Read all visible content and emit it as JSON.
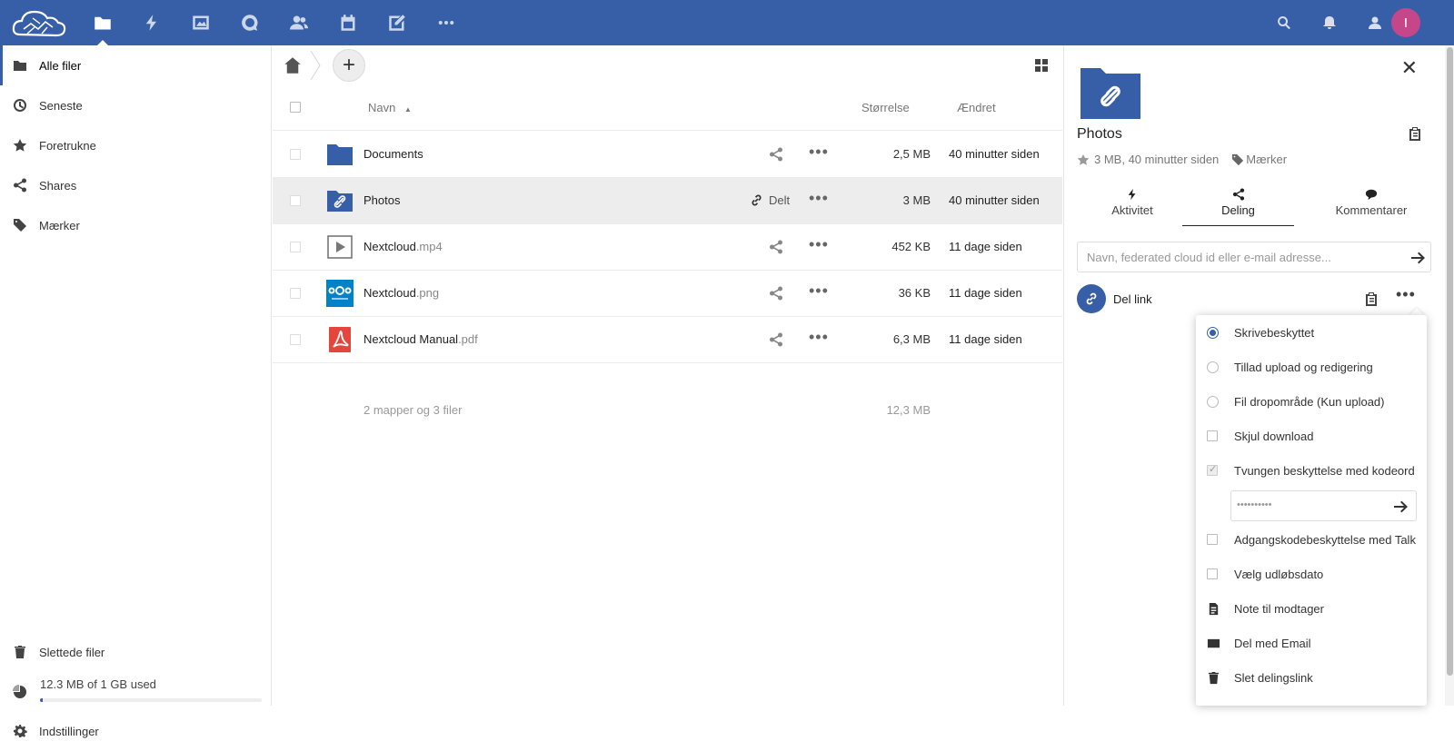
{
  "header": {
    "apps": [
      "files-icon",
      "activity-icon",
      "photos-icon",
      "talk-icon",
      "contacts-icon",
      "calendar-icon",
      "notes-icon",
      "more-apps-icon"
    ],
    "avatar_letter": "I"
  },
  "nav": {
    "items": [
      {
        "label": "Alle filer",
        "icon": "folder-icon"
      },
      {
        "label": "Seneste",
        "icon": "clock-icon"
      },
      {
        "label": "Foretrukne",
        "icon": "star-icon"
      },
      {
        "label": "Shares",
        "icon": "share-icon"
      },
      {
        "label": "Mærker",
        "icon": "tag-icon"
      }
    ],
    "deleted": "Slettede filer",
    "quota_text": "12.3 MB of 1 GB used",
    "quota_fraction": 0.012,
    "settings": "Indstillinger"
  },
  "table": {
    "col_name": "Navn",
    "col_size": "Størrelse",
    "col_modified": "Ændret",
    "rows": [
      {
        "name": "Documents",
        "ext": "",
        "size": "2,5 MB",
        "modified": "40 minutter siden",
        "type": "folder"
      },
      {
        "name": "Photos",
        "ext": "",
        "size": "3 MB",
        "modified": "40 minutter siden",
        "type": "shared-folder",
        "shared_label": "Delt"
      },
      {
        "name": "Nextcloud",
        "ext": ".mp4",
        "size": "452 KB",
        "modified": "11 dage siden",
        "type": "video"
      },
      {
        "name": "Nextcloud",
        "ext": ".png",
        "size": "36 KB",
        "modified": "11 dage siden",
        "type": "image"
      },
      {
        "name": "Nextcloud Manual",
        "ext": ".pdf",
        "size": "6,3 MB",
        "modified": "11 dage siden",
        "type": "pdf"
      }
    ],
    "summary_count": "2 mapper og 3 filer",
    "summary_size": "12,3 MB"
  },
  "sidebar": {
    "title": "Photos",
    "meta": "3 MB, 40 minutter siden",
    "tags": "Mærker",
    "tabs": [
      "Aktivitet",
      "Deling",
      "Kommentarer"
    ],
    "share_placeholder": "Navn, federated cloud id eller e-mail adresse...",
    "link_label": "Del link"
  },
  "share_menu": {
    "read_only": "Skrivebeskyttet",
    "allow_upload": "Tillad upload og redigering",
    "file_drop": "Fil dropområde (Kun upload)",
    "hide_download": "Skjul download",
    "enforce_password": "Tvungen beskyttelse med kodeord",
    "password_value": "••••••••••",
    "talk_password": "Adgangskodebeskyttelse med Talk",
    "expiry": "Vælg udløbsdato",
    "note": "Note til modtager",
    "email": "Del med Email",
    "delete": "Slet delingslink"
  },
  "colors": {
    "brand": "#375fa8",
    "avatar": "#c6468a"
  }
}
